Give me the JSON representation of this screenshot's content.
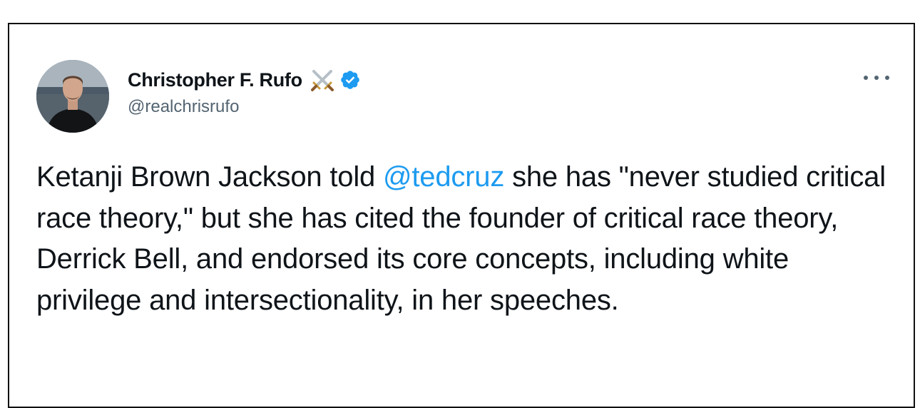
{
  "tweet": {
    "author_name": "Christopher F. Rufo",
    "author_handle": "@realchrisrufo",
    "text_before_mention": "Ketanji Brown Jackson told ",
    "mention": "@tedcruz",
    "text_after_mention": " she has \"never studied critical race theory,\" but she has cited the founder of critical race theory, Derrick Bell, and endorsed its core concepts, including white privilege and intersectionality, in her speeches."
  },
  "icons": {
    "name_emoji": "crossed-swords-icon",
    "badge": "verified-badge-icon",
    "menu": "more-options-icon"
  },
  "colors": {
    "mention": "#1d9bf0",
    "verified": "#1d9bf0",
    "text": "#0f1419",
    "secondary_text": "#536471"
  }
}
